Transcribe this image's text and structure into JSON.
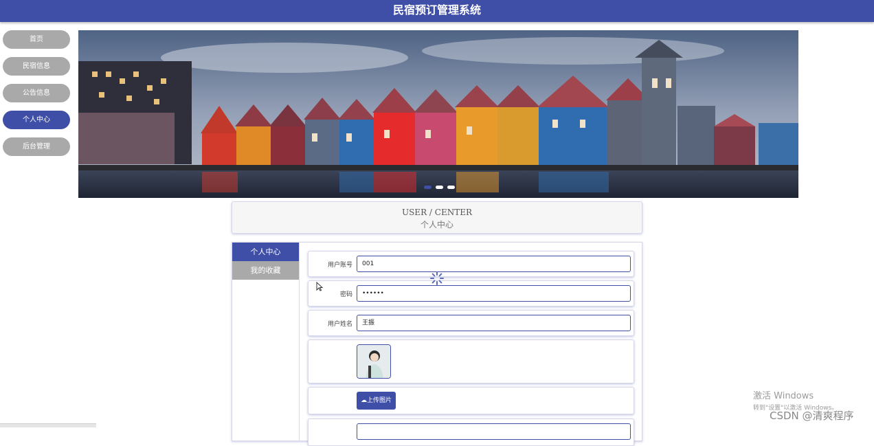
{
  "header": {
    "title": "民宿预订管理系统"
  },
  "nav": {
    "items": [
      "首页",
      "民宿信息",
      "公告信息",
      "个人中心",
      "后台管理"
    ],
    "active": 3
  },
  "center": {
    "en": "USER / CENTER",
    "cn": "个人中心"
  },
  "tabs": [
    "个人中心",
    "我的收藏"
  ],
  "form": {
    "account_label": "用户账号",
    "account_value": "001",
    "password_label": "密码",
    "password_value": "••••••",
    "name_label": "用户姓名",
    "name_value": "王振",
    "upload_label": "上传图片"
  },
  "watermark": {
    "line1": "激活 Windows",
    "line2": "转到\"设置\"以激活 Windows。"
  },
  "credit": "CSDN @清爽程序",
  "colors": {
    "primary": "#3f4fa8",
    "inactive": "#a9a9a9"
  }
}
